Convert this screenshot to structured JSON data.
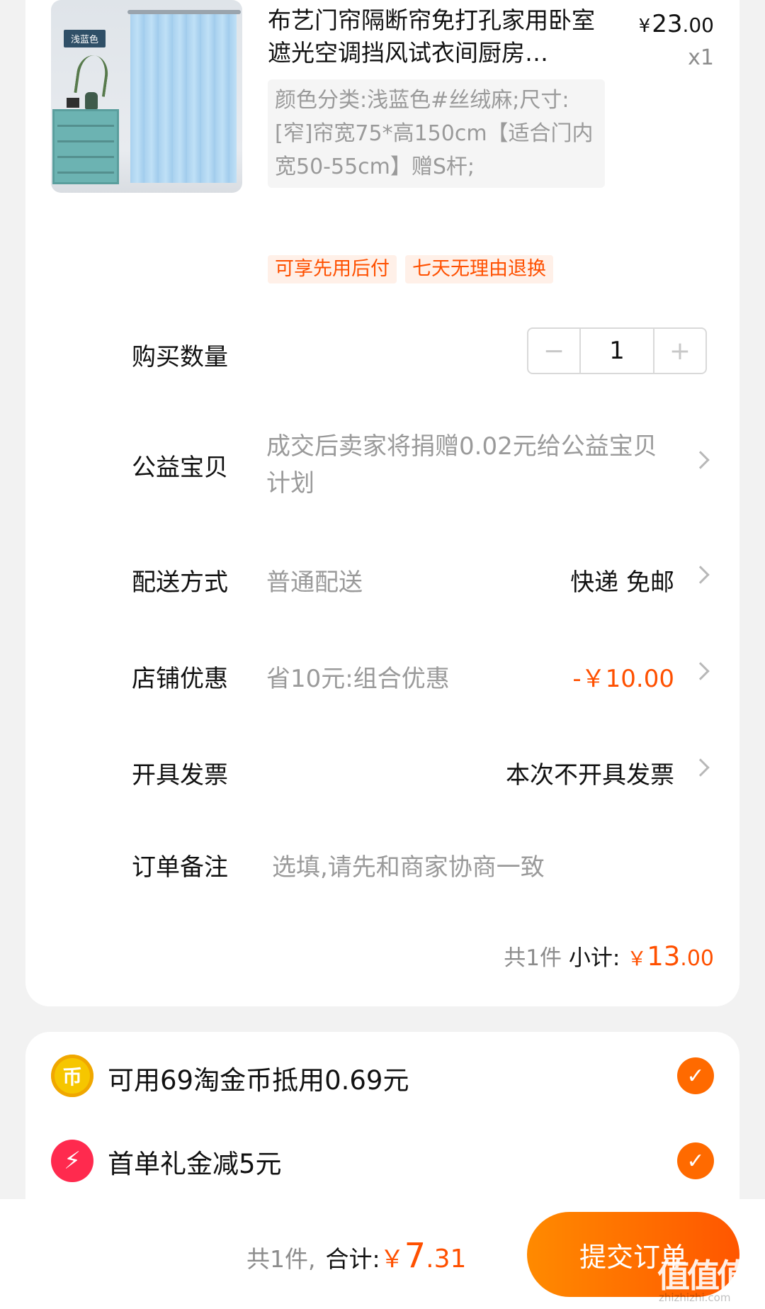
{
  "product": {
    "image_tag": "浅蓝色",
    "title": "布艺门帘隔断帘免打孔家用卧室遮光空调挡风试衣间厨房…",
    "price_currency": "¥",
    "price_int": "23",
    "price_dec": ".00",
    "quantity_label": "x1",
    "sku": "颜色分类:浅蓝色#丝绒麻;尺寸:[窄]帘宽75*高150cm【适合门内宽50-55cm】赠S杆;"
  },
  "badges": [
    "可享先用后付",
    "七天无理由退换"
  ],
  "rows": {
    "quantity": {
      "label": "购买数量",
      "minus": "−",
      "value": "1",
      "plus": "+"
    },
    "charity": {
      "label": "公益宝贝",
      "value": "成交后卖家将捐赠0.02元给公益宝贝计划"
    },
    "shipping": {
      "label": "配送方式",
      "value": "普通配送",
      "right": "快递 免邮"
    },
    "store_discount": {
      "label": "店铺优惠",
      "value": "省10元:组合优惠",
      "right": "-￥10.00"
    },
    "invoice": {
      "label": "开具发票",
      "right": "本次不开具发票"
    },
    "note": {
      "label": "订单备注",
      "placeholder": "选填,请先和商家协商一致"
    }
  },
  "subtotal": {
    "count": "共1件",
    "label": "小计:",
    "currency": "￥",
    "int": "13",
    "dec": ".00"
  },
  "options": [
    {
      "icon": "taojinbi-coin-icon",
      "glyph": "币",
      "text": "可用69淘金币抵用0.69元",
      "checked": true
    },
    {
      "icon": "lightning-icon",
      "glyph": "⚡",
      "text": "首单礼金减5元",
      "checked": true
    }
  ],
  "footer": {
    "count": "共1件,",
    "label": "合计:",
    "currency": "￥",
    "int": "7",
    "dec": ".31",
    "submit_label": "提交订单"
  },
  "watermark": {
    "logo": "值值值",
    "url": "zhizhizhi.com"
  },
  "colors": {
    "accent": "#ff5000",
    "button": "#ff6a00",
    "coin": "#f6c600",
    "bolt": "#ff2a4e"
  }
}
